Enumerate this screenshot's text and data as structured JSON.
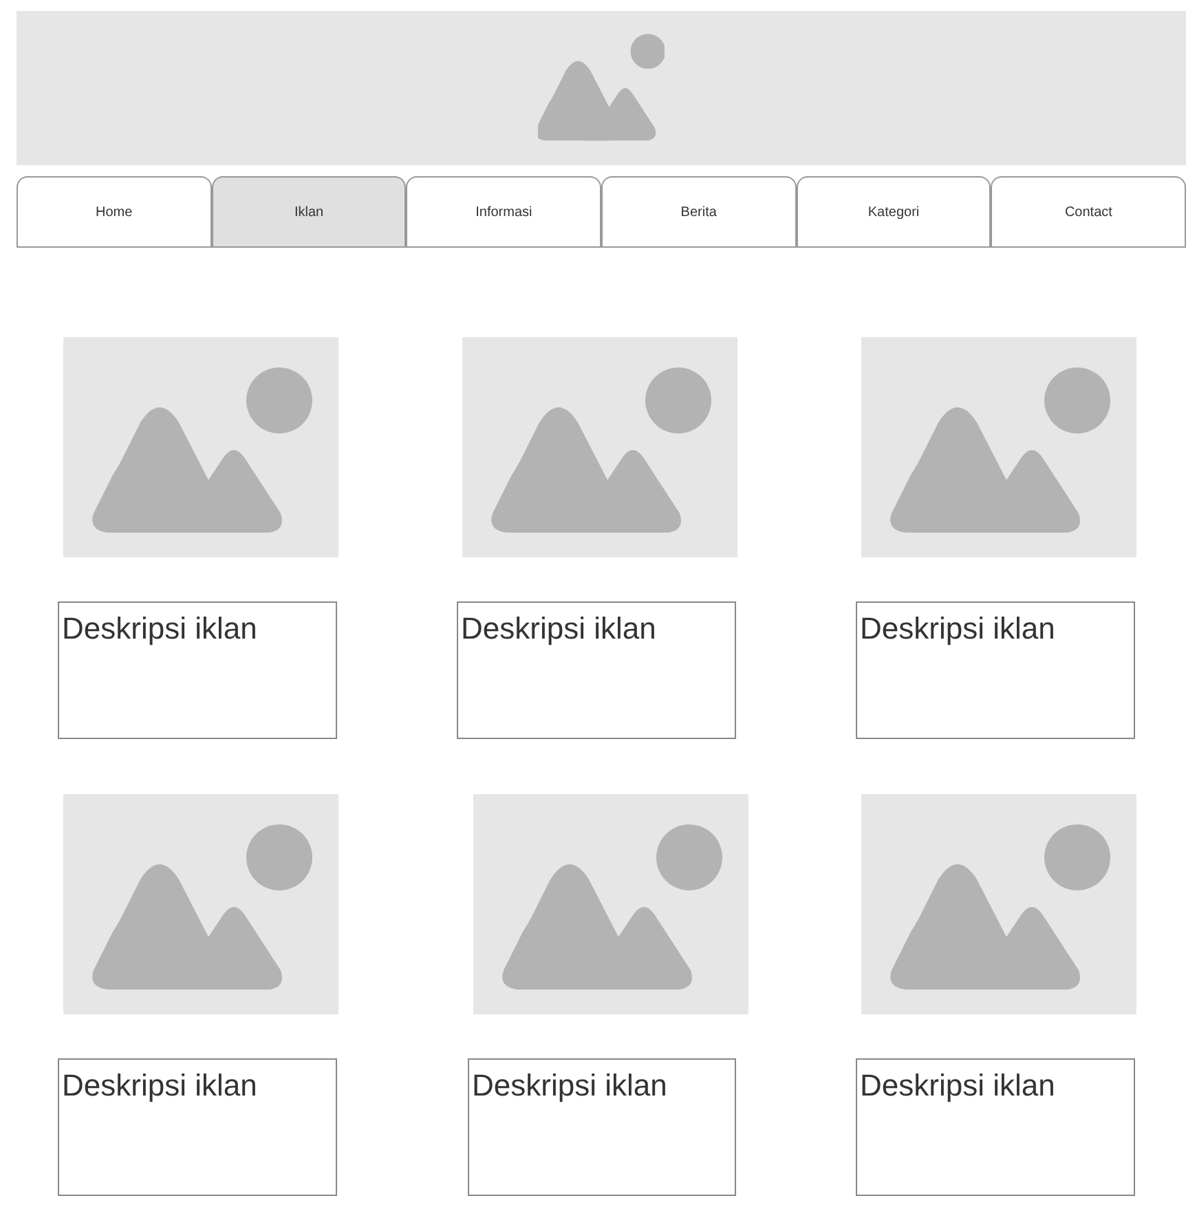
{
  "nav_tabs": [
    {
      "label": "Home",
      "selected": false
    },
    {
      "label": "Iklan",
      "selected": true
    },
    {
      "label": "Informasi",
      "selected": false
    },
    {
      "label": "Berita",
      "selected": false
    },
    {
      "label": "Kategori",
      "selected": false
    },
    {
      "label": "Contact",
      "selected": false
    }
  ],
  "ads": [
    {
      "description": "Deskripsi iklan"
    },
    {
      "description": "Deskripsi iklan"
    },
    {
      "description": "Deskripsi iklan"
    },
    {
      "description": "Deskripsi iklan"
    },
    {
      "description": "Deskripsi iklan"
    },
    {
      "description": "Deskripsi iklan"
    }
  ]
}
